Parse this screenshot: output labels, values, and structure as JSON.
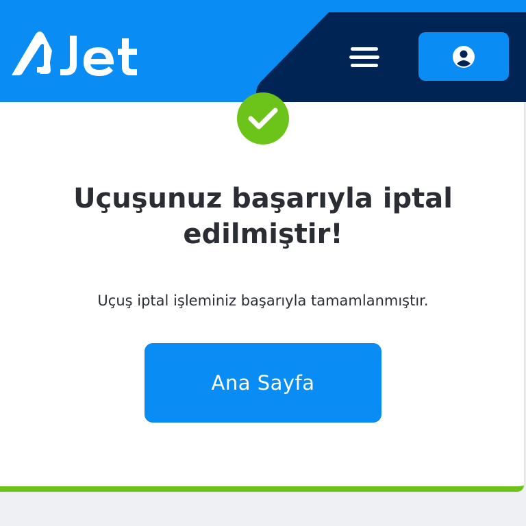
{
  "header": {
    "logo_text": "AJet",
    "menu_icon": "hamburger-menu-icon",
    "account_icon": "user-circle-icon"
  },
  "confirmation": {
    "status_icon": "check-circle-icon",
    "title": "Uçuşunuz başarıyla iptal edilmiştir!",
    "message": "Uçuş iptal işleminiz başarıyla tamamlanmıştır.",
    "home_button_label": "Ana Sayfa"
  },
  "colors": {
    "brand_blue": "#0a8cf5",
    "navy": "#002554",
    "success_green": "#6cc41a",
    "text": "#2a2d34"
  }
}
